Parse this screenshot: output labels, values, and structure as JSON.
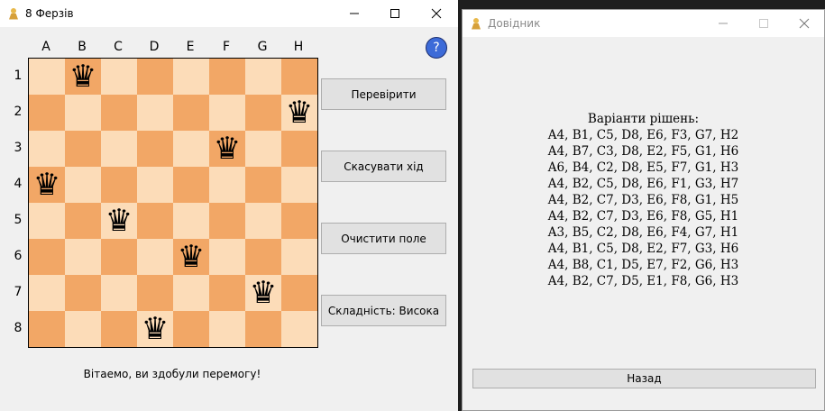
{
  "main_window": {
    "title": "8 Ферзів",
    "files": [
      "A",
      "B",
      "C",
      "D",
      "E",
      "F",
      "G",
      "H"
    ],
    "ranks": [
      "1",
      "2",
      "3",
      "4",
      "5",
      "6",
      "7",
      "8"
    ],
    "queen_glyph": "♛",
    "queens": [
      {
        "file": "B",
        "rank": 1
      },
      {
        "file": "H",
        "rank": 2
      },
      {
        "file": "F",
        "rank": 3
      },
      {
        "file": "A",
        "rank": 4
      },
      {
        "file": "C",
        "rank": 5
      },
      {
        "file": "E",
        "rank": 6
      },
      {
        "file": "G",
        "rank": 7
      },
      {
        "file": "D",
        "rank": 8
      }
    ],
    "help_label": "?",
    "buttons": {
      "check": "Перевірити",
      "undo": "Скасувати хід",
      "clear": "Очистити поле",
      "difficulty": "Складність: Висока"
    },
    "status": "Вітаемо, ви здобули перемогу!",
    "colors": {
      "light_square": "#fcdcb8",
      "dark_square": "#f2a766",
      "help_button": "#3d6bd8"
    }
  },
  "help_window": {
    "title": "Довідник",
    "heading": "Варіанти рішень:",
    "solutions": [
      "A4, B1, C5, D8, E6, F3, G7, H2",
      "A4, B7, C3, D8, E2, F5, G1, H6",
      "A6, B4, C2, D8, E5, F7, G1, H3",
      "A4, B2, C5, D8, E6, F1, G3, H7",
      "A4, B2, C7, D3, E6, F8, G1, H5",
      "A4, B2, C7, D3, E6, F8, G5, H1",
      "A3, B5, C2, D8, E6, F4, G7, H1",
      "A4, B1, C5, D8, E2, F7, G3, H6",
      "A4, B8, C1, D5, E7, F2, G6, H3",
      "A4, B2, C7, D5, E1, F8, G6, H3"
    ],
    "back_label": "Назад"
  }
}
